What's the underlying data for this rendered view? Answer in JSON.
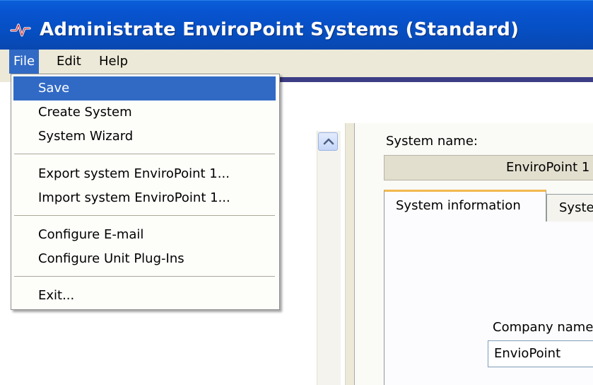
{
  "window": {
    "title": "Administrate EnviroPoint Systems (Standard)",
    "icon": "enviropoint-logo-icon"
  },
  "menubar": {
    "items": [
      {
        "label": "File"
      },
      {
        "label": "Edit"
      },
      {
        "label": "Help"
      }
    ]
  },
  "file_menu": {
    "items": [
      {
        "label": "Save"
      },
      {
        "label": "Create System"
      },
      {
        "label": "System Wizard"
      },
      {
        "label": "Export system EnviroPoint 1..."
      },
      {
        "label": "Import system EnviroPoint 1..."
      },
      {
        "label": "Configure E-mail"
      },
      {
        "label": "Configure Unit Plug-Ins"
      },
      {
        "label": "Exit..."
      }
    ]
  },
  "detail": {
    "system_name_label": "System name:",
    "system_name_value": "EnviroPoint 1",
    "tabs": [
      {
        "label": "System information"
      },
      {
        "label": "Syste"
      }
    ],
    "company_label": "Company name",
    "company_value": "EnvioPoint"
  },
  "colors": {
    "title_bar": "#0853cf",
    "menu_highlight": "#316ac5",
    "tab_accent": "#f2b84e",
    "accent_bar": "#3d3d86"
  }
}
